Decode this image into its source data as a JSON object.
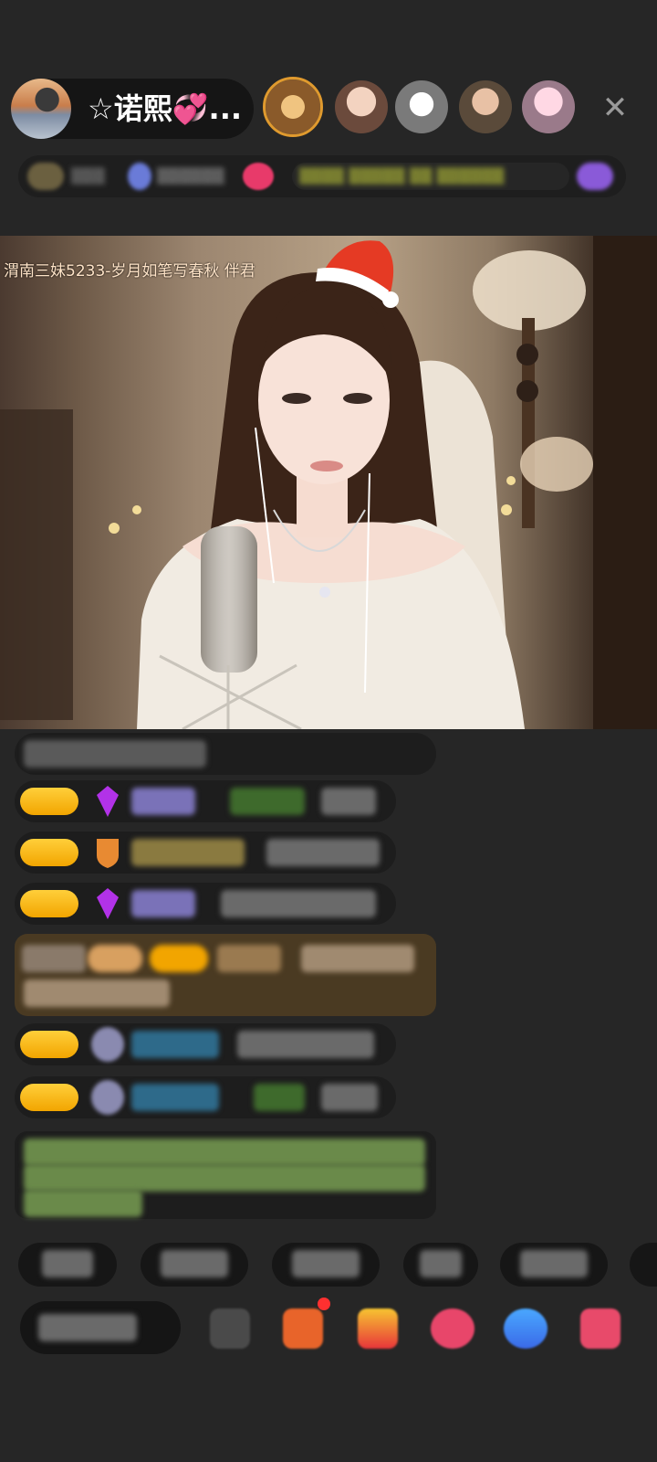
{
  "header": {
    "host_name": "☆诺熙💞...",
    "close_icon": "✕",
    "viewer_avatars": [
      "viewer-1",
      "viewer-2",
      "viewer-3",
      "viewer-4",
      "viewer-5"
    ]
  },
  "video": {
    "caption": "渭南三妹5233-岁月如笔写春秋 伴君"
  },
  "colors": {
    "background": "#262626",
    "level_badge": "#f2a500",
    "gift_message_bg": "#4a3a22",
    "heart_pink": "#ff4fa0"
  }
}
